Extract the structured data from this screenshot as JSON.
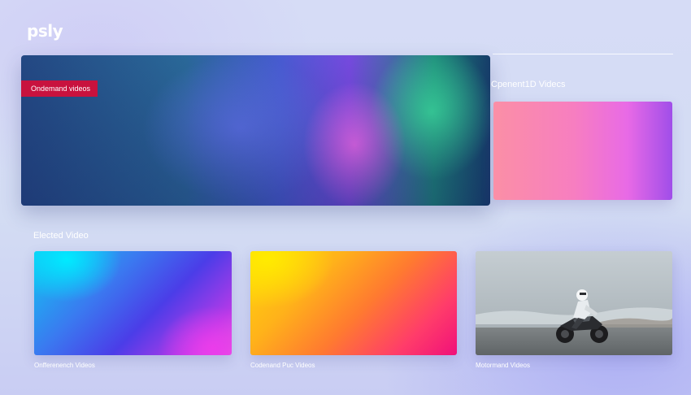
{
  "app": {
    "logo": "psly"
  },
  "hero": {
    "badge_label": "Ondemand videos"
  },
  "side": {
    "title": "Cpenent1D Videcs"
  },
  "section": {
    "title": "Elected Video"
  },
  "cards": [
    {
      "label": "Onfferenench Videos"
    },
    {
      "label": "Codenand Puc Videos"
    },
    {
      "label": "Motormand Videos"
    }
  ],
  "colors": {
    "badge": "#c8123e",
    "text": "#ffffff"
  }
}
